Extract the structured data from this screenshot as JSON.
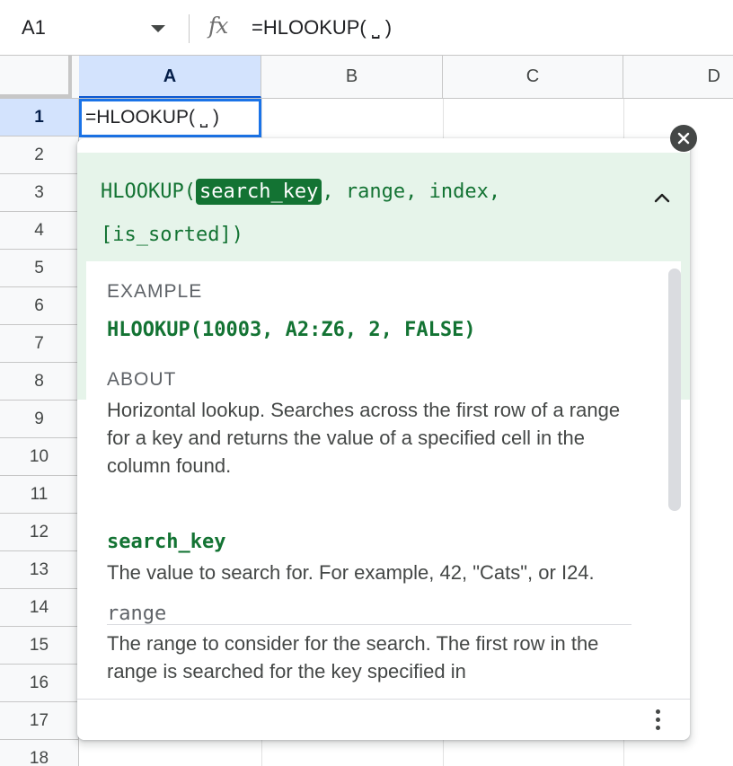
{
  "formula_bar": {
    "name_box": "A1",
    "fx_label": "fx",
    "formula": "=HLOOKUP( ⎵ )"
  },
  "columns": [
    "A",
    "B",
    "C",
    "D"
  ],
  "rows": [
    "1",
    "2",
    "3",
    "4",
    "5",
    "6",
    "7",
    "8",
    "9",
    "10",
    "11",
    "12",
    "13",
    "14",
    "15",
    "16",
    "17",
    "18"
  ],
  "active_cell": {
    "ref": "A1",
    "text": "=HLOOKUP( ⎵ )"
  },
  "help_popup": {
    "signature": {
      "prefix": "HLOOKUP(",
      "highlighted_arg": "search_key",
      "rest_line1": ", range, index,",
      "rest_line2": "[is_sorted])"
    },
    "example_label": "EXAMPLE",
    "example": "HLOOKUP(10003, A2:Z6, 2, FALSE)",
    "about_label": "ABOUT",
    "about_text": "Horizontal lookup. Searches across the first row of a range for a key and returns the value of a specified cell in the column found.",
    "args": [
      {
        "name": "search_key",
        "desc": "The value to search for. For example, 42, \"Cats\", or I24."
      },
      {
        "name": "range",
        "desc": "The range to consider for the search. The first row in the range is searched for the key specified in"
      }
    ]
  },
  "colors": {
    "accent_blue": "#1a73e8",
    "header_selected": "#d3e3fd",
    "popup_green_bg": "#e6f4ea",
    "green_text": "#137333"
  }
}
